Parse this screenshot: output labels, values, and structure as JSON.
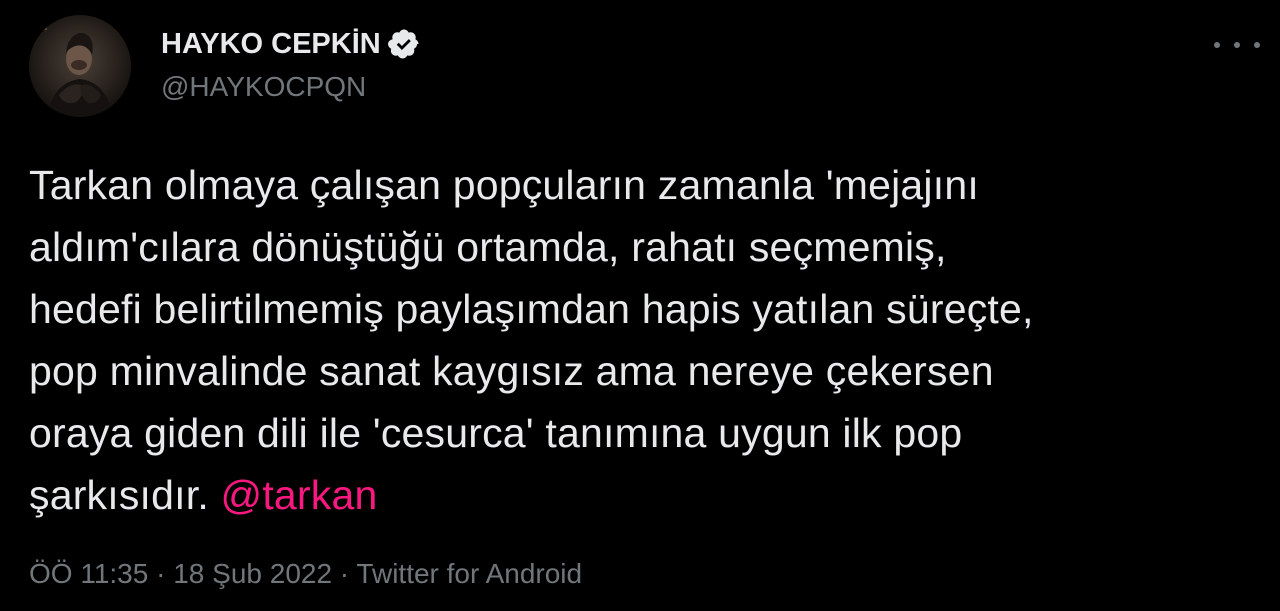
{
  "colors": {
    "background": "#000000",
    "text": "#e7e9ea",
    "secondary": "#71767b",
    "mention": "#f91880",
    "verified": "#e7e9ea"
  },
  "author": {
    "name": "HAYKO CEPKİN",
    "handle": "@HAYKOCPQN",
    "verified_icon": "verified-badge-icon",
    "avatar_icon": "avatar-photo"
  },
  "menu": {
    "more_icon": "more-horizontal-icon"
  },
  "tweet": {
    "lines": [
      "Tarkan olmaya çalışan popçuların zamanla 'mejajını",
      "aldım'cılara dönüştüğü ortamda, rahatı seçmemiş,",
      "hedefi belirtilmemiş paylaşımdan hapis yatılan süreçte,",
      "pop minvalinde sanat kaygısız ama nereye çekersen",
      "oraya giden dili ile 'cesurca' tanımına uygun ilk pop",
      "şarkısıdır."
    ],
    "mention": "@tarkan"
  },
  "meta": {
    "time": "ÖÖ 11:35",
    "separator1": " · ",
    "date": "18 Şub 2022",
    "separator2": " · ",
    "source": "Twitter for Android"
  }
}
